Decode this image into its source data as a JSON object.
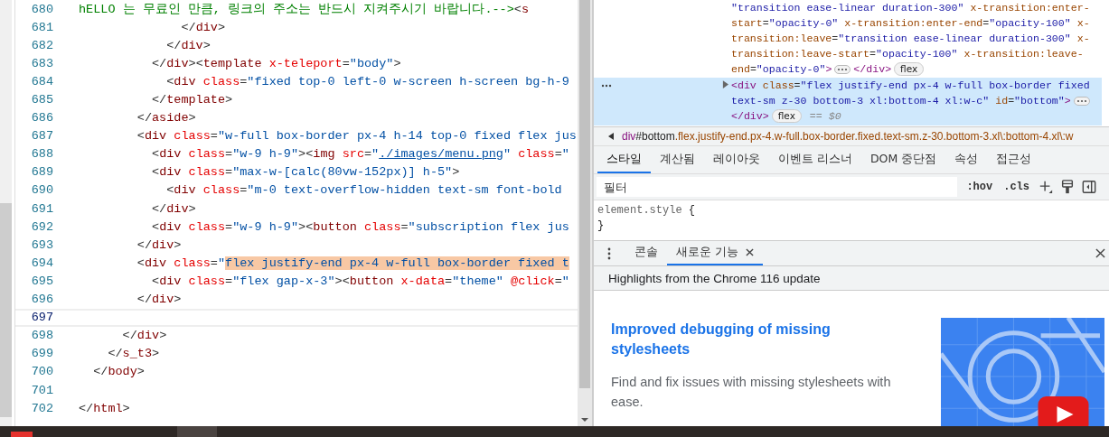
{
  "editor": {
    "lines": [
      {
        "number": "680",
        "current": false,
        "tokens": [
          {
            "kind": "comment",
            "text": "hELLO 는 무료인 만큼, 링크의 주소는 반드시 지켜주시기 바랍니다.-->"
          },
          {
            "kind": "punct",
            "text": "<"
          },
          {
            "kind": "tag",
            "text": "s"
          }
        ]
      },
      {
        "number": "681",
        "current": false,
        "tokens": [
          {
            "kind": "punct",
            "text": "              </"
          },
          {
            "kind": "tag",
            "text": "div"
          },
          {
            "kind": "punct",
            "text": ">"
          }
        ]
      },
      {
        "number": "682",
        "current": false,
        "tokens": [
          {
            "kind": "punct",
            "text": "            </"
          },
          {
            "kind": "tag",
            "text": "div"
          },
          {
            "kind": "punct",
            "text": ">"
          }
        ]
      },
      {
        "number": "683",
        "current": false,
        "tokens": [
          {
            "kind": "punct",
            "text": "          </"
          },
          {
            "kind": "tag",
            "text": "div"
          },
          {
            "kind": "punct",
            "text": "><"
          },
          {
            "kind": "tag",
            "text": "template"
          },
          {
            "kind": "attr",
            "text": " x-teleport"
          },
          {
            "kind": "punct",
            "text": "="
          },
          {
            "kind": "str",
            "text": "\"body\""
          },
          {
            "kind": "punct",
            "text": ">"
          }
        ]
      },
      {
        "number": "684",
        "current": false,
        "tokens": [
          {
            "kind": "punct",
            "text": "            <"
          },
          {
            "kind": "tag",
            "text": "div"
          },
          {
            "kind": "attr",
            "text": " class"
          },
          {
            "kind": "punct",
            "text": "="
          },
          {
            "kind": "str",
            "text": "\"fixed top-0 left-0 w-screen h-screen bg-h-9"
          }
        ]
      },
      {
        "number": "685",
        "current": false,
        "tokens": [
          {
            "kind": "punct",
            "text": "          </"
          },
          {
            "kind": "tag",
            "text": "template"
          },
          {
            "kind": "punct",
            "text": ">"
          }
        ]
      },
      {
        "number": "686",
        "current": false,
        "tokens": [
          {
            "kind": "punct",
            "text": "        </"
          },
          {
            "kind": "tag",
            "text": "aside"
          },
          {
            "kind": "punct",
            "text": ">"
          }
        ]
      },
      {
        "number": "687",
        "current": false,
        "tokens": [
          {
            "kind": "punct",
            "text": "        <"
          },
          {
            "kind": "tag",
            "text": "div"
          },
          {
            "kind": "attr",
            "text": " class"
          },
          {
            "kind": "punct",
            "text": "="
          },
          {
            "kind": "str",
            "text": "\"w-full box-border px-4 h-14 top-0 fixed flex jus"
          }
        ]
      },
      {
        "number": "688",
        "current": false,
        "tokens": [
          {
            "kind": "punct",
            "text": "          <"
          },
          {
            "kind": "tag",
            "text": "div"
          },
          {
            "kind": "attr",
            "text": " class"
          },
          {
            "kind": "punct",
            "text": "="
          },
          {
            "kind": "str",
            "text": "\"w-9 h-9\""
          },
          {
            "kind": "punct",
            "text": "><"
          },
          {
            "kind": "tag",
            "text": "img"
          },
          {
            "kind": "attr",
            "text": " src"
          },
          {
            "kind": "punct",
            "text": "="
          },
          {
            "kind": "str",
            "text": "\""
          },
          {
            "kind": "link",
            "text": "./images/menu.png"
          },
          {
            "kind": "str",
            "text": "\""
          },
          {
            "kind": "attr",
            "text": " class"
          },
          {
            "kind": "punct",
            "text": "="
          },
          {
            "kind": "str",
            "text": "\""
          }
        ]
      },
      {
        "number": "689",
        "current": false,
        "tokens": [
          {
            "kind": "punct",
            "text": "          <"
          },
          {
            "kind": "tag",
            "text": "div"
          },
          {
            "kind": "attr",
            "text": " class"
          },
          {
            "kind": "punct",
            "text": "="
          },
          {
            "kind": "str",
            "text": "\"max-w-[calc(80vw-152px)] h-5\""
          },
          {
            "kind": "punct",
            "text": ">"
          }
        ]
      },
      {
        "number": "690",
        "current": false,
        "tokens": [
          {
            "kind": "punct",
            "text": "            <"
          },
          {
            "kind": "tag",
            "text": "div"
          },
          {
            "kind": "attr",
            "text": " class"
          },
          {
            "kind": "punct",
            "text": "="
          },
          {
            "kind": "str",
            "text": "\"m-0 text-overflow-hidden text-sm font-bold"
          }
        ]
      },
      {
        "number": "691",
        "current": false,
        "tokens": [
          {
            "kind": "punct",
            "text": "          </"
          },
          {
            "kind": "tag",
            "text": "div"
          },
          {
            "kind": "punct",
            "text": ">"
          }
        ]
      },
      {
        "number": "692",
        "current": false,
        "tokens": [
          {
            "kind": "punct",
            "text": "          <"
          },
          {
            "kind": "tag",
            "text": "div"
          },
          {
            "kind": "attr",
            "text": " class"
          },
          {
            "kind": "punct",
            "text": "="
          },
          {
            "kind": "str",
            "text": "\"w-9 h-9\""
          },
          {
            "kind": "punct",
            "text": "><"
          },
          {
            "kind": "tag",
            "text": "button"
          },
          {
            "kind": "attr",
            "text": " class"
          },
          {
            "kind": "punct",
            "text": "="
          },
          {
            "kind": "str",
            "text": "\"subscription flex jus"
          }
        ]
      },
      {
        "number": "693",
        "current": false,
        "tokens": [
          {
            "kind": "punct",
            "text": "        </"
          },
          {
            "kind": "tag",
            "text": "div"
          },
          {
            "kind": "punct",
            "text": ">"
          }
        ]
      },
      {
        "number": "694",
        "current": false,
        "tokens": [
          {
            "kind": "punct",
            "text": "        <"
          },
          {
            "kind": "tag",
            "text": "div"
          },
          {
            "kind": "attr",
            "text": " class"
          },
          {
            "kind": "punct",
            "text": "="
          },
          {
            "kind": "str",
            "text": "\""
          },
          {
            "kind": "str",
            "text": "flex justify-end px-4 w-full box-border fixed t",
            "highlighted": true
          }
        ]
      },
      {
        "number": "695",
        "current": false,
        "tokens": [
          {
            "kind": "punct",
            "text": "          <"
          },
          {
            "kind": "tag",
            "text": "div"
          },
          {
            "kind": "attr",
            "text": " class"
          },
          {
            "kind": "punct",
            "text": "="
          },
          {
            "kind": "str",
            "text": "\"flex gap-x-3\""
          },
          {
            "kind": "punct",
            "text": "><"
          },
          {
            "kind": "tag",
            "text": "button"
          },
          {
            "kind": "attr",
            "text": " x-data"
          },
          {
            "kind": "punct",
            "text": "="
          },
          {
            "kind": "str",
            "text": "\"theme\""
          },
          {
            "kind": "attr",
            "text": " @click"
          },
          {
            "kind": "punct",
            "text": "="
          },
          {
            "kind": "str",
            "text": "\""
          }
        ]
      },
      {
        "number": "696",
        "current": false,
        "tokens": [
          {
            "kind": "punct",
            "text": "        </"
          },
          {
            "kind": "tag",
            "text": "div"
          },
          {
            "kind": "punct",
            "text": ">"
          }
        ]
      },
      {
        "number": "697",
        "current": true
      },
      {
        "number": "698",
        "current": false,
        "tokens": [
          {
            "kind": "punct",
            "text": "      </"
          },
          {
            "kind": "tag",
            "text": "div"
          },
          {
            "kind": "punct",
            "text": ">"
          }
        ]
      },
      {
        "number": "699",
        "current": false,
        "tokens": [
          {
            "kind": "punct",
            "text": "    </"
          },
          {
            "kind": "tag",
            "text": "s_t3"
          },
          {
            "kind": "punct",
            "text": ">"
          }
        ]
      },
      {
        "number": "700",
        "current": false,
        "tokens": [
          {
            "kind": "punct",
            "text": "  </"
          },
          {
            "kind": "tag",
            "text": "body"
          },
          {
            "kind": "punct",
            "text": ">"
          }
        ]
      },
      {
        "number": "701",
        "current": false
      },
      {
        "number": "702",
        "current": false,
        "tokens": [
          {
            "kind": "punct",
            "text": "</"
          },
          {
            "kind": "tag",
            "text": "html"
          },
          {
            "kind": "punct",
            "text": ">"
          }
        ]
      }
    ]
  },
  "devtools": {
    "dom_nodes": [
      {
        "selected": false,
        "collapsed": false,
        "lines": [
          [
            {
              "kind": "str",
              "text": "\"transition ease-linear duration-300\""
            },
            {
              "kind": "attr",
              "text": " x-transition:enter-"
            }
          ],
          [
            {
              "kind": "attr",
              "text": "start"
            },
            {
              "kind": "punct",
              "text": "="
            },
            {
              "kind": "str",
              "text": "\"opacity-0\""
            },
            {
              "kind": "attr",
              "text": " x-transition:enter-end"
            },
            {
              "kind": "punct",
              "text": "="
            },
            {
              "kind": "str",
              "text": "\"opacity-100\""
            },
            {
              "kind": "attr",
              "text": " x-"
            }
          ],
          [
            {
              "kind": "attr",
              "text": "transition:leave"
            },
            {
              "kind": "punct",
              "text": "="
            },
            {
              "kind": "str",
              "text": "\"transition ease-linear duration-300\""
            },
            {
              "kind": "attr",
              "text": " x-"
            }
          ],
          [
            {
              "kind": "attr",
              "text": "transition:leave-start"
            },
            {
              "kind": "punct",
              "text": "="
            },
            {
              "kind": "str",
              "text": "\"opacity-100\""
            },
            {
              "kind": "attr",
              "text": " x-transition:leave-"
            }
          ],
          [
            {
              "kind": "attr",
              "text": "end"
            },
            {
              "kind": "punct",
              "text": "="
            },
            {
              "kind": "str",
              "text": "\"opacity-0\""
            },
            {
              "kind": "tag",
              "text": ">"
            },
            {
              "kind": "ellipsis"
            },
            {
              "kind": "tag",
              "text": "</div>"
            },
            {
              "kind": "badge",
              "text": "flex"
            }
          ]
        ]
      },
      {
        "selected": true,
        "collapsed": true,
        "lines": [
          [
            {
              "kind": "tag",
              "text": "<div"
            },
            {
              "kind": "attr",
              "text": " class"
            },
            {
              "kind": "punct",
              "text": "="
            },
            {
              "kind": "str",
              "text": "\"flex justify-end px-4 w-full box-border fixed"
            }
          ],
          [
            {
              "kind": "str",
              "text": "text-sm z-30 bottom-3 xl:bottom-4 xl:w-c\""
            },
            {
              "kind": "attr",
              "text": " id"
            },
            {
              "kind": "punct",
              "text": "="
            },
            {
              "kind": "str",
              "text": "\"bottom\""
            },
            {
              "kind": "tag",
              "text": ">"
            },
            {
              "kind": "ellipsis"
            }
          ],
          [
            {
              "kind": "tag",
              "text": "</div>"
            },
            {
              "kind": "badge",
              "text": "flex"
            },
            {
              "kind": "dim",
              "text": "== $0"
            }
          ]
        ]
      }
    ],
    "breadcrumb": [
      {
        "kind": "tag",
        "text": "div"
      },
      {
        "kind": "id",
        "text": "#bottom"
      },
      {
        "kind": "class",
        "text": ".flex.justify-end.px-4.w-full.box-border.fixed.text-sm.z-30.bottom-3.xl\\:bottom-4.xl\\:w"
      }
    ],
    "tabs": [
      {
        "label": "스타일",
        "selected": true
      },
      {
        "label": "계산됨",
        "selected": false
      },
      {
        "label": "레이아웃",
        "selected": false
      },
      {
        "label": "이벤트 리스너",
        "selected": false
      },
      {
        "label": "DOM 중단점",
        "selected": false
      },
      {
        "label": "속성",
        "selected": false
      },
      {
        "label": "접근성",
        "selected": false
      }
    ],
    "filter": {
      "placeholder": "필터"
    },
    "filter_buttons": [
      ":hov",
      ".cls"
    ],
    "style_rule": {
      "selector": "element.style",
      "open": "{",
      "close": "}"
    },
    "drawer_tabs": [
      {
        "label": "콘솔",
        "selected": false,
        "closable": false
      },
      {
        "label": "새로운 기능",
        "selected": true,
        "closable": true
      }
    ],
    "whats_new": {
      "title": "Highlights from the Chrome 116 update",
      "heading": "Improved debugging of missing stylesheets",
      "body": "Find and fix issues with missing stylesheets with ease."
    }
  }
}
